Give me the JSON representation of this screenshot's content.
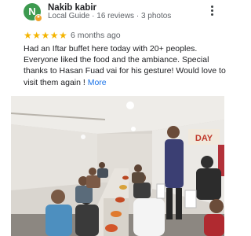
{
  "reviewer": {
    "avatar_letter": "N",
    "name": "Nakib kabir",
    "meta": "Local Guide · 16 reviews · 3 photos"
  },
  "review": {
    "rating": 5,
    "stars": "★★★★★",
    "date": "6 months ago",
    "text": "Had an Iftar buffet here today with 20+ peoples. Everyone liked the food and the ambiance. Special thanks to Hasan Fuad vai for his gesture! Would love to visit them again !",
    "more_link": "More"
  },
  "photo": {
    "wall_sign": "DAY"
  },
  "icons": {
    "avatar_badge": "local-guide-badge-icon",
    "menu": "more-vert-icon"
  },
  "colors": {
    "avatar": "#3d9a4f",
    "star": "#f4b400",
    "link": "#1a73e8"
  }
}
